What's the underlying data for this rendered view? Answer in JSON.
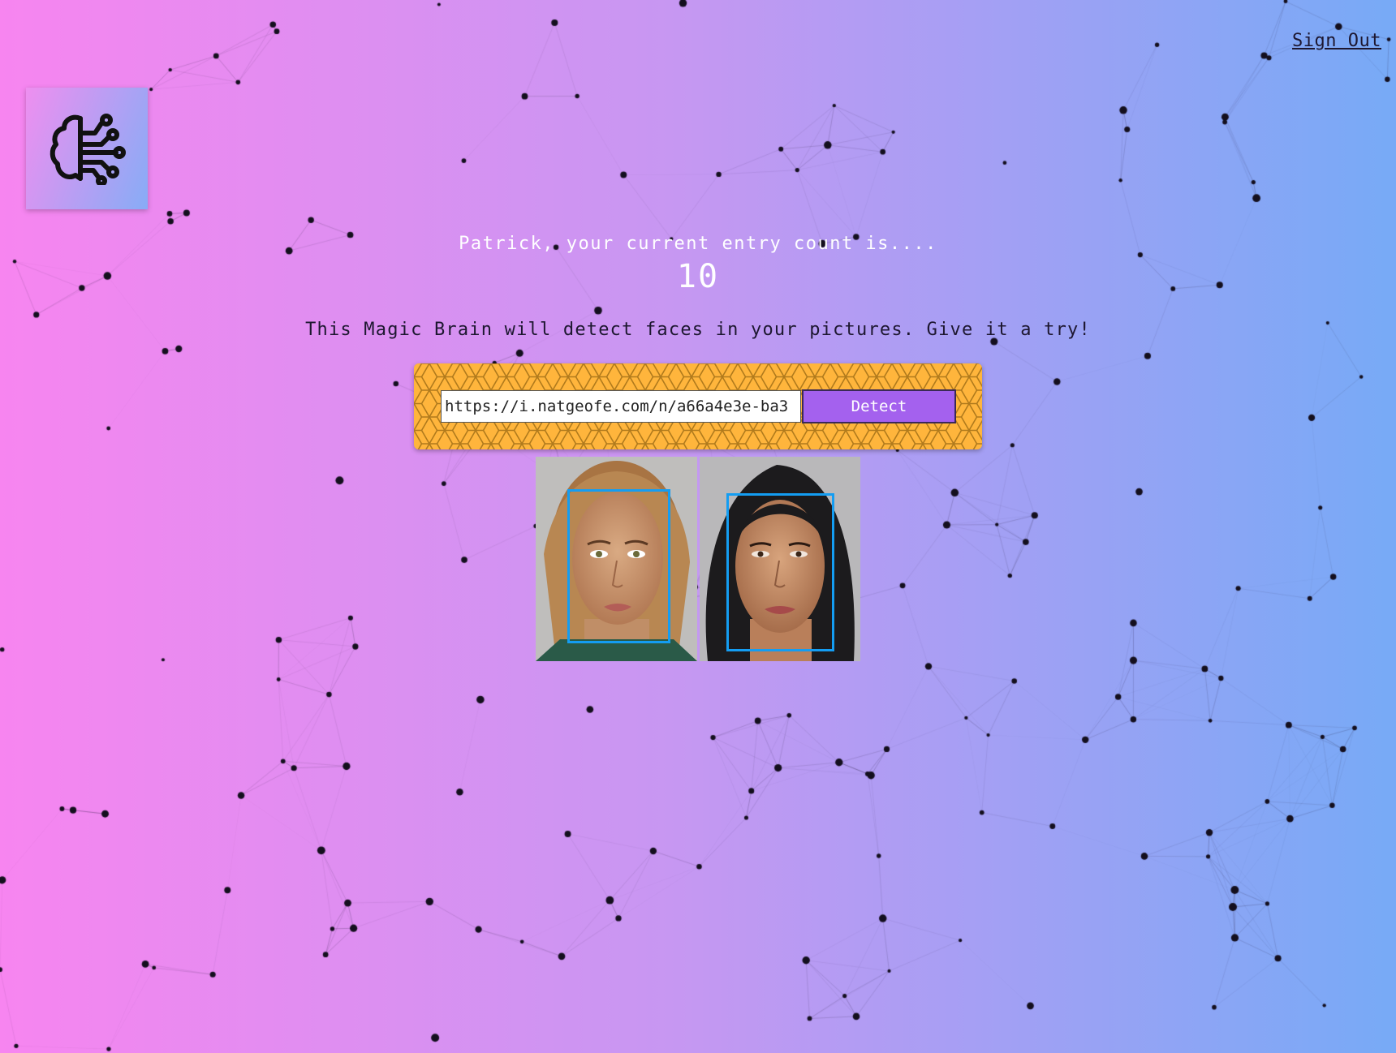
{
  "nav": {
    "signout_label": "Sign Out"
  },
  "logo": {
    "icon": "brain-circuit-icon"
  },
  "rank": {
    "message": "Patrick, your current entry count is....",
    "count": "10"
  },
  "tagline": "This Magic Brain will detect faces in your pictures. Give it a try!",
  "form": {
    "url_value": "https://i.natgeofe.com/n/a66a4e3e-ba3",
    "button_label": "Detect"
  },
  "detection": {
    "faces_detected": 2
  },
  "colors": {
    "gradient_left": "#f785f0",
    "gradient_right": "#77aaf6",
    "panel": "#ffb53c",
    "button": "#a461ee",
    "face_box": "#149df2"
  }
}
